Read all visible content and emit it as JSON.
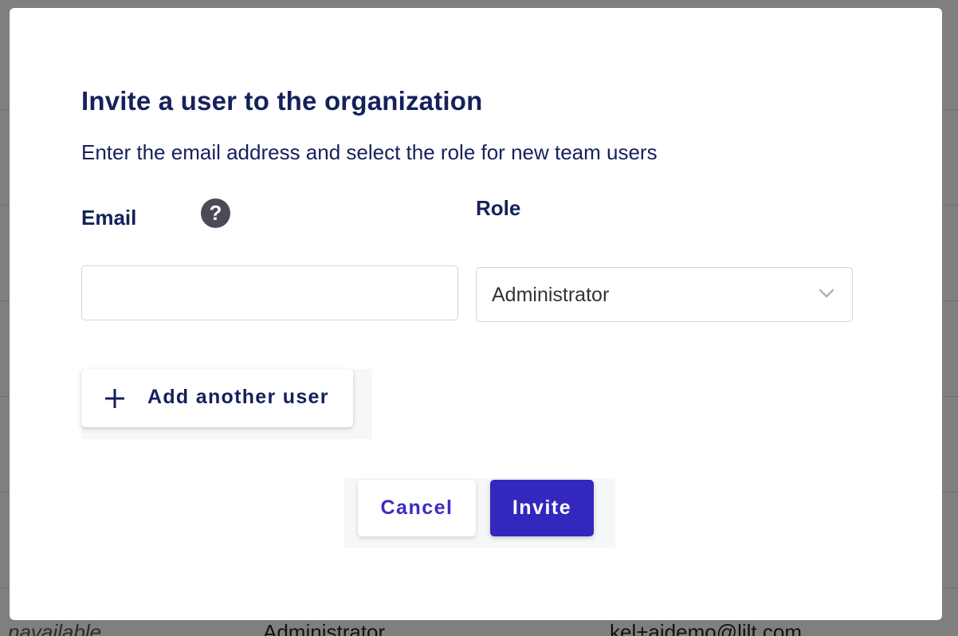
{
  "background": {
    "bottom_row": {
      "status": "navailable",
      "role": "Administrator",
      "email": "kel+aidemo@lilt.com"
    }
  },
  "modal": {
    "title": "Invite a user to the organization",
    "subtitle": "Enter the email address and select the role for new team users",
    "email": {
      "label": "Email",
      "value": "",
      "placeholder": "",
      "help_icon": "question-circle-icon",
      "help_glyph": "?"
    },
    "role": {
      "label": "Role",
      "selected": "Administrator",
      "dropdown_icon": "chevron-down-icon"
    },
    "add_user": {
      "label": "Add another user",
      "icon": "plus-icon"
    },
    "actions": {
      "cancel_label": "Cancel",
      "invite_label": "Invite"
    }
  },
  "colors": {
    "title": "#14215c",
    "primary": "#3427bd",
    "overlay": "rgba(0,0,0,0.5)"
  }
}
